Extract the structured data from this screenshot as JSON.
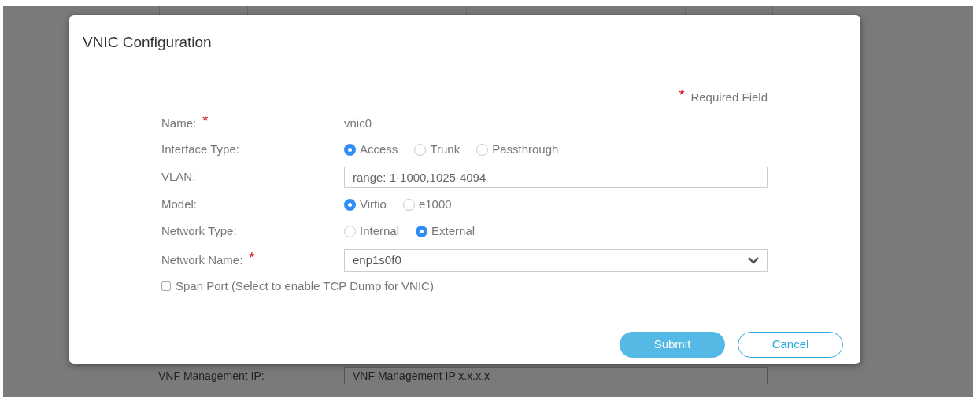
{
  "dialog": {
    "title": "VNIC Configuration",
    "required_note": "Required Field",
    "required_mark": "*",
    "fields": [
      {
        "kind": "text",
        "label": "Name:",
        "required": true,
        "value": "vnic0"
      },
      {
        "kind": "radio",
        "label": "Interface Type:",
        "required": false,
        "options": [
          {
            "label": "Access",
            "selected": true
          },
          {
            "label": "Trunk",
            "selected": false
          },
          {
            "label": "Passthrough",
            "selected": false
          }
        ]
      },
      {
        "kind": "input",
        "label": "VLAN:",
        "required": false,
        "placeholder": "range: 1-1000,1025-4094"
      },
      {
        "kind": "radio",
        "label": "Model:",
        "required": false,
        "options": [
          {
            "label": "Virtio",
            "selected": true
          },
          {
            "label": "e1000",
            "selected": false
          }
        ]
      },
      {
        "kind": "radio",
        "label": "Network Type:",
        "required": false,
        "options": [
          {
            "label": "Internal",
            "selected": false
          },
          {
            "label": "External",
            "selected": true
          }
        ]
      },
      {
        "kind": "select",
        "label": "Network Name:",
        "required": true,
        "value": "enp1s0f0"
      }
    ],
    "span_port": {
      "label": "Span Port (Select to enable TCP Dump for VNIC)",
      "checked": false
    },
    "buttons": [
      {
        "label": "Submit",
        "kind": "primary"
      },
      {
        "label": "Cancel",
        "kind": "secondary"
      }
    ]
  },
  "background": {
    "label": "VNF Management IP:",
    "placeholder": "VNF Management IP x.x.x.x"
  }
}
